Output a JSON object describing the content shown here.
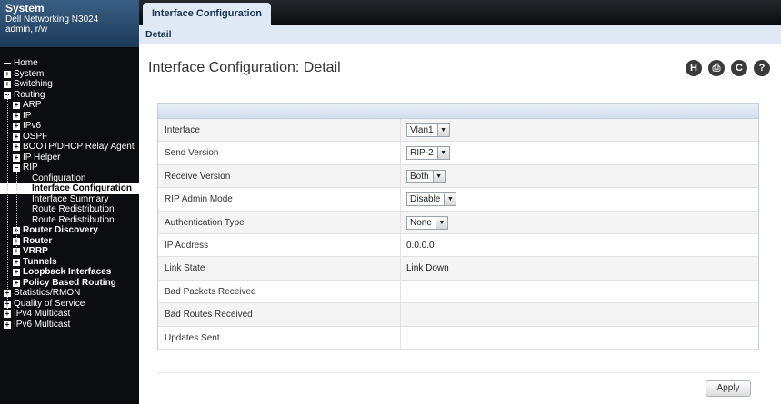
{
  "sidebar": {
    "system": {
      "title": "System",
      "model": "Dell Networking N3024",
      "user": "admin, r/w"
    },
    "items": [
      {
        "label": "Home",
        "toggle": "none",
        "level": 0
      },
      {
        "label": "System",
        "toggle": "+",
        "level": 0
      },
      {
        "label": "Switching",
        "toggle": "+",
        "level": 0
      },
      {
        "label": "Routing",
        "toggle": "-",
        "level": 0
      },
      {
        "label": "ARP",
        "toggle": "+",
        "level": 1
      },
      {
        "label": "IP",
        "toggle": "+",
        "level": 1
      },
      {
        "label": "IPv6",
        "toggle": "+",
        "level": 1
      },
      {
        "label": "OSPF",
        "toggle": "+",
        "level": 1
      },
      {
        "label": "BOOTP/DHCP Relay Agent",
        "toggle": "+",
        "level": 1
      },
      {
        "label": "IP Helper",
        "toggle": "+",
        "level": 1
      },
      {
        "label": "RIP",
        "toggle": "-",
        "level": 1
      },
      {
        "label": "Configuration",
        "toggle": "none",
        "level": 2
      },
      {
        "label": "Interface Configuration",
        "toggle": "none",
        "level": 2,
        "selected": true
      },
      {
        "label": "Interface Summary",
        "toggle": "none",
        "level": 2
      },
      {
        "label": "Route Redistribution",
        "toggle": "none",
        "level": 2
      },
      {
        "label": "Route Redistribution",
        "toggle": "none",
        "level": 2
      },
      {
        "label": "Router Discovery",
        "toggle": "+",
        "level": 1
      },
      {
        "label": "Router",
        "toggle": "+",
        "level": 1
      },
      {
        "label": "VRRP",
        "toggle": "+",
        "level": 1
      },
      {
        "label": "Tunnels",
        "toggle": "+",
        "level": 1
      },
      {
        "label": "Loopback Interfaces",
        "toggle": "+",
        "level": 1
      },
      {
        "label": "Policy Based Routing",
        "toggle": "+",
        "level": 1
      },
      {
        "label": "Statistics/RMON",
        "toggle": "+",
        "level": 0
      },
      {
        "label": "Quality of Service",
        "toggle": "+",
        "level": 0
      },
      {
        "label": "IPv4 Multicast",
        "toggle": "+",
        "level": 0
      },
      {
        "label": "IPv6 Multicast",
        "toggle": "+",
        "level": 0
      }
    ]
  },
  "tabs": {
    "active": "Interface Configuration",
    "sub": "Detail"
  },
  "page": {
    "title": "Interface Configuration: Detail",
    "toolbar": [
      {
        "name": "help-h-icon",
        "glyph": "H"
      },
      {
        "name": "print-icon",
        "glyph": "⎙"
      },
      {
        "name": "refresh-icon",
        "glyph": "C"
      },
      {
        "name": "question-icon",
        "glyph": "?"
      }
    ]
  },
  "form": {
    "rows": [
      {
        "label": "Interface",
        "value": "Vlan1",
        "type": "select"
      },
      {
        "label": "Send Version",
        "value": "RIP-2",
        "type": "select"
      },
      {
        "label": "Receive Version",
        "value": "Both",
        "type": "select"
      },
      {
        "label": "RIP Admin Mode",
        "value": "Disable",
        "type": "select"
      },
      {
        "label": "Authentication Type",
        "value": "None",
        "type": "select"
      },
      {
        "label": "IP Address",
        "value": "0.0.0.0",
        "type": "text"
      },
      {
        "label": "Link State",
        "value": "Link Down",
        "type": "text"
      },
      {
        "label": "Bad Packets Received",
        "value": "",
        "type": "text"
      },
      {
        "label": "Bad Routes Received",
        "value": "",
        "type": "text"
      },
      {
        "label": "Updates Sent",
        "value": "",
        "type": "text"
      }
    ]
  },
  "buttons": {
    "apply": "Apply"
  },
  "colors": {
    "sidebar_bg": "#0b0d10",
    "tab_bg": "#dfe9f5",
    "accent": "#18324f"
  }
}
